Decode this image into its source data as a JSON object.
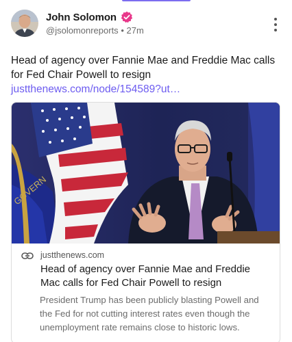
{
  "post": {
    "author_name": "John Solomon",
    "handle": "@jsolomonreports",
    "separator": "•",
    "time": "27m",
    "text": "Head of agency over Fannie Mae and Freddie Mac calls for Fed Chair Powell to resign",
    "link_text": "justthenews.com/node/154589?ut…"
  },
  "card": {
    "domain": "justthenews.com",
    "title": "Head of agency over Fannie Mae and Freddie Mac calls for Fed Chair Powell to resign",
    "description": "President Trump has been publicly blasting Powell and the Fed for not cutting interest rates even though the unemployment rate remains close to historic lows."
  },
  "colors": {
    "accent": "#7c6cf0",
    "link": "#6d5cf0",
    "verified_badge": "#e8388a"
  },
  "icons": [
    "avatar-photo",
    "verified-badge-icon",
    "more-options-icon",
    "link-icon"
  ]
}
